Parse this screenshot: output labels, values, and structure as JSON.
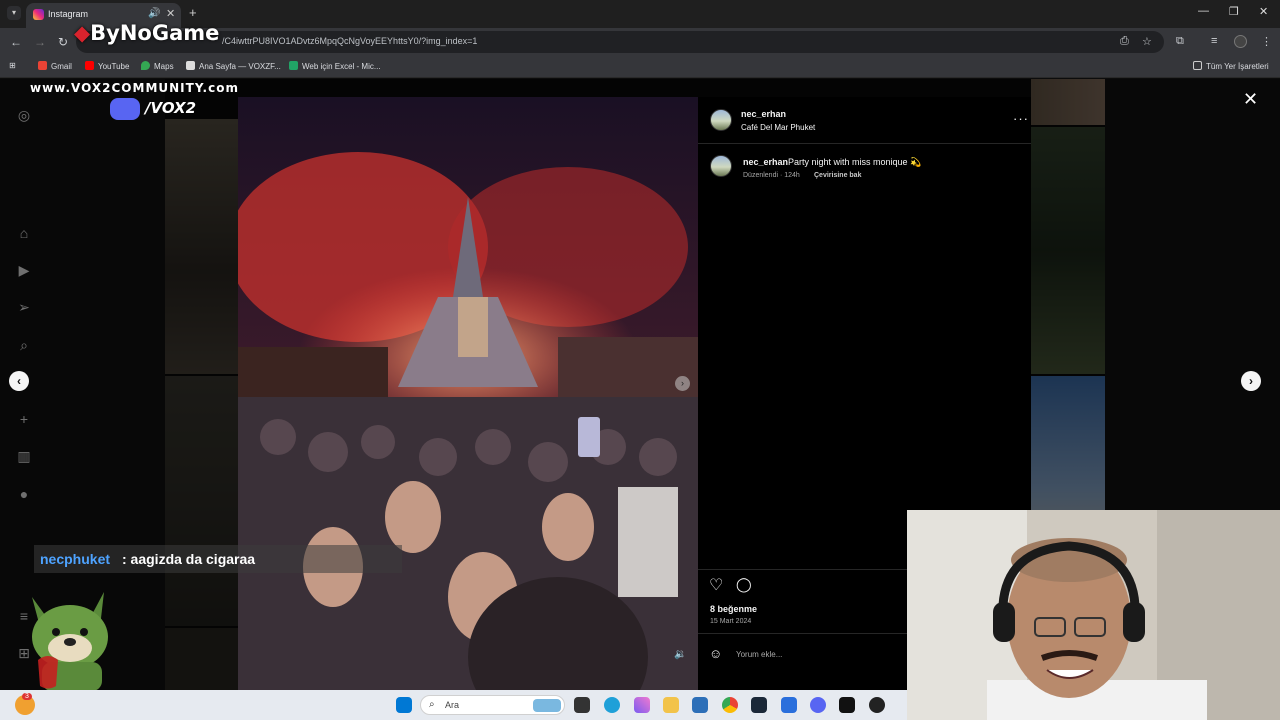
{
  "browser": {
    "tab_title": "Instagram",
    "url": "/C4iwttrPU8IVO1ADvtz6MpqQcNgVoyEEYhttsY0/?img_index=1",
    "bookmarks": [
      {
        "label": "Gmail",
        "color": "#ea4335"
      },
      {
        "label": "YouTube",
        "color": "#ff0000"
      },
      {
        "label": "Maps",
        "color": "#34a853"
      },
      {
        "label": "Ana Sayfa — VOXZF...",
        "color": "#dddddd"
      },
      {
        "label": "Web için Excel - Mic...",
        "color": "#21a366"
      }
    ],
    "all_bookmarks": "Tüm Yer İşaretleri"
  },
  "overlay": {
    "logo": "ByNoGame",
    "watermark_site": "www.VOX2COMMUNITY.com",
    "watermark_discord": "/VOX2"
  },
  "post": {
    "username": "nec_erhan",
    "location": "Café Del Mar Phuket",
    "caption_user": "nec_erhan",
    "caption": "Party night with miss monique 💫",
    "edited": "Düzenlendi · 124h",
    "translate": "Çevirisine bak",
    "likes": "8 beğenme",
    "date": "15 Mart 2024",
    "comment_placeholder": "Yorum ekle..."
  },
  "chat": {
    "user": "necphuket",
    "message": ": aagizda da cigaraa"
  },
  "taskbar": {
    "search_label": "Ara",
    "notification_count": "3"
  }
}
